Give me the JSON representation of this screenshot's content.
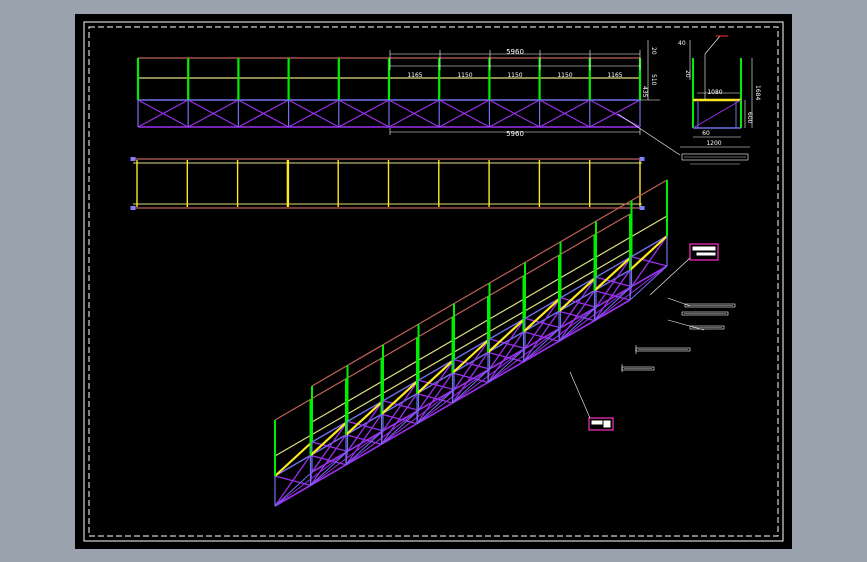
{
  "colors": {
    "workspace": "#9aa3ad",
    "paper": "#000000",
    "frame": "#ffffff",
    "post": "#00ee00",
    "rail_top": "#c0605a",
    "rail_mid": "#dede80",
    "rail_low": "#7070ee",
    "truss": "#9a30ee",
    "deck": "#ffe820",
    "dim": "#ffffff",
    "tag": "#ff30c0"
  },
  "elevation": {
    "overall_top": "5960",
    "overall_bottom": "5960",
    "bays": [
      "1165",
      "1150",
      "1150",
      "1150",
      "1165"
    ],
    "right_dims": [
      "20",
      "510",
      "435"
    ]
  },
  "section": {
    "dims_top": [
      "40",
      "20"
    ],
    "width_upper": "1080",
    "height": "1684",
    "lower_right": "600",
    "bottom_small": "60",
    "bottom_width": "1200"
  }
}
